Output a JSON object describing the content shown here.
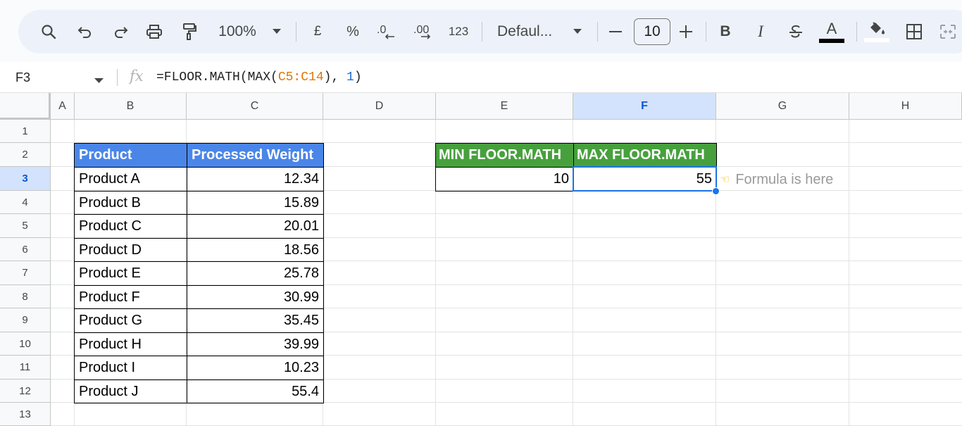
{
  "toolbar": {
    "zoom": "100%",
    "currency": "£",
    "percent": "%",
    "more_formats": "123",
    "font_name": "Defaul...",
    "font_size": "10",
    "bold": "B",
    "italic": "I",
    "text_color_letter": "A"
  },
  "formula_bar": {
    "name_box": "F3",
    "fx": "fx",
    "formula_prefix": "=FLOOR.MATH(MAX(",
    "formula_ref": "C5:C14",
    "formula_mid": "), ",
    "formula_arg": "1",
    "formula_suffix": ")"
  },
  "columns": [
    "A",
    "B",
    "C",
    "D",
    "E",
    "F",
    "G",
    "H"
  ],
  "selected_column": "F",
  "rows": [
    "1",
    "2",
    "3",
    "4",
    "5",
    "6",
    "7",
    "8",
    "9",
    "10",
    "11",
    "12",
    "13"
  ],
  "selected_row": "3",
  "table": {
    "header_product": "Product",
    "header_weight": "Processed Weight",
    "rows": [
      {
        "product": "Product A",
        "weight": "12.34"
      },
      {
        "product": "Product B",
        "weight": "15.89"
      },
      {
        "product": "Product C",
        "weight": "20.01"
      },
      {
        "product": "Product D",
        "weight": "18.56"
      },
      {
        "product": "Product E",
        "weight": "25.78"
      },
      {
        "product": "Product F",
        "weight": "30.99"
      },
      {
        "product": "Product G",
        "weight": "35.45"
      },
      {
        "product": "Product H",
        "weight": "39.99"
      },
      {
        "product": "Product I",
        "weight": "10.23"
      },
      {
        "product": "Product J",
        "weight": "55.4"
      }
    ]
  },
  "results": {
    "min_header": "MIN FLOOR.MATH",
    "max_header": "MAX FLOOR.MATH",
    "min_value": "10",
    "max_value": "55"
  },
  "note": {
    "icon": "backhand-pointing-left-icon",
    "text": "Formula is here"
  },
  "colors": {
    "header_blue": "#4a86e8",
    "header_green": "#47a03d",
    "selection": "#1a73e8"
  }
}
